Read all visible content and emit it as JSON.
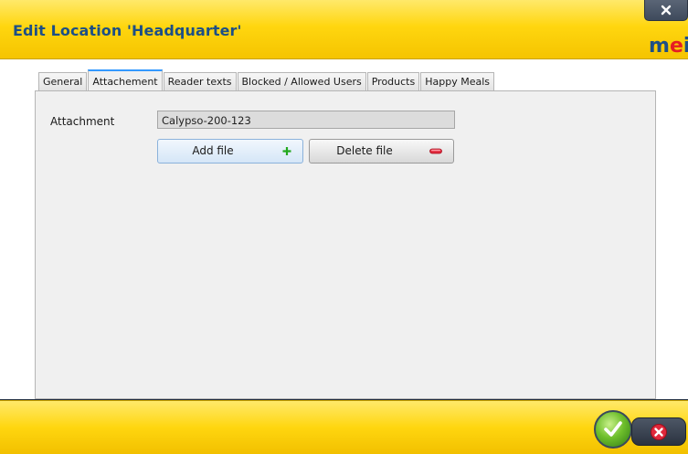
{
  "window": {
    "title": "Edit Location 'Headquarter'",
    "logo_text": "mei"
  },
  "tabs": [
    {
      "label": "General"
    },
    {
      "label": "Attachement",
      "active": true
    },
    {
      "label": "Reader texts"
    },
    {
      "label": "Blocked / Allowed Users"
    },
    {
      "label": "Products"
    },
    {
      "label": "Happy Meals"
    }
  ],
  "attachment": {
    "label": "Attachment",
    "value": "Calypso-200-123"
  },
  "buttons": {
    "add_file": "Add file",
    "delete_file": "Delete file"
  },
  "icons": {
    "close": "close-icon",
    "add": "plus-icon",
    "delete": "minus-icon",
    "ok": "check-icon",
    "cancel": "x-icon"
  },
  "colors": {
    "title_bar": "#ffd60f",
    "title_text": "#1d4f86",
    "active_tab_accent": "#3399ff",
    "ok_green": "#6fbf2c",
    "cancel_red": "#e0283b"
  }
}
